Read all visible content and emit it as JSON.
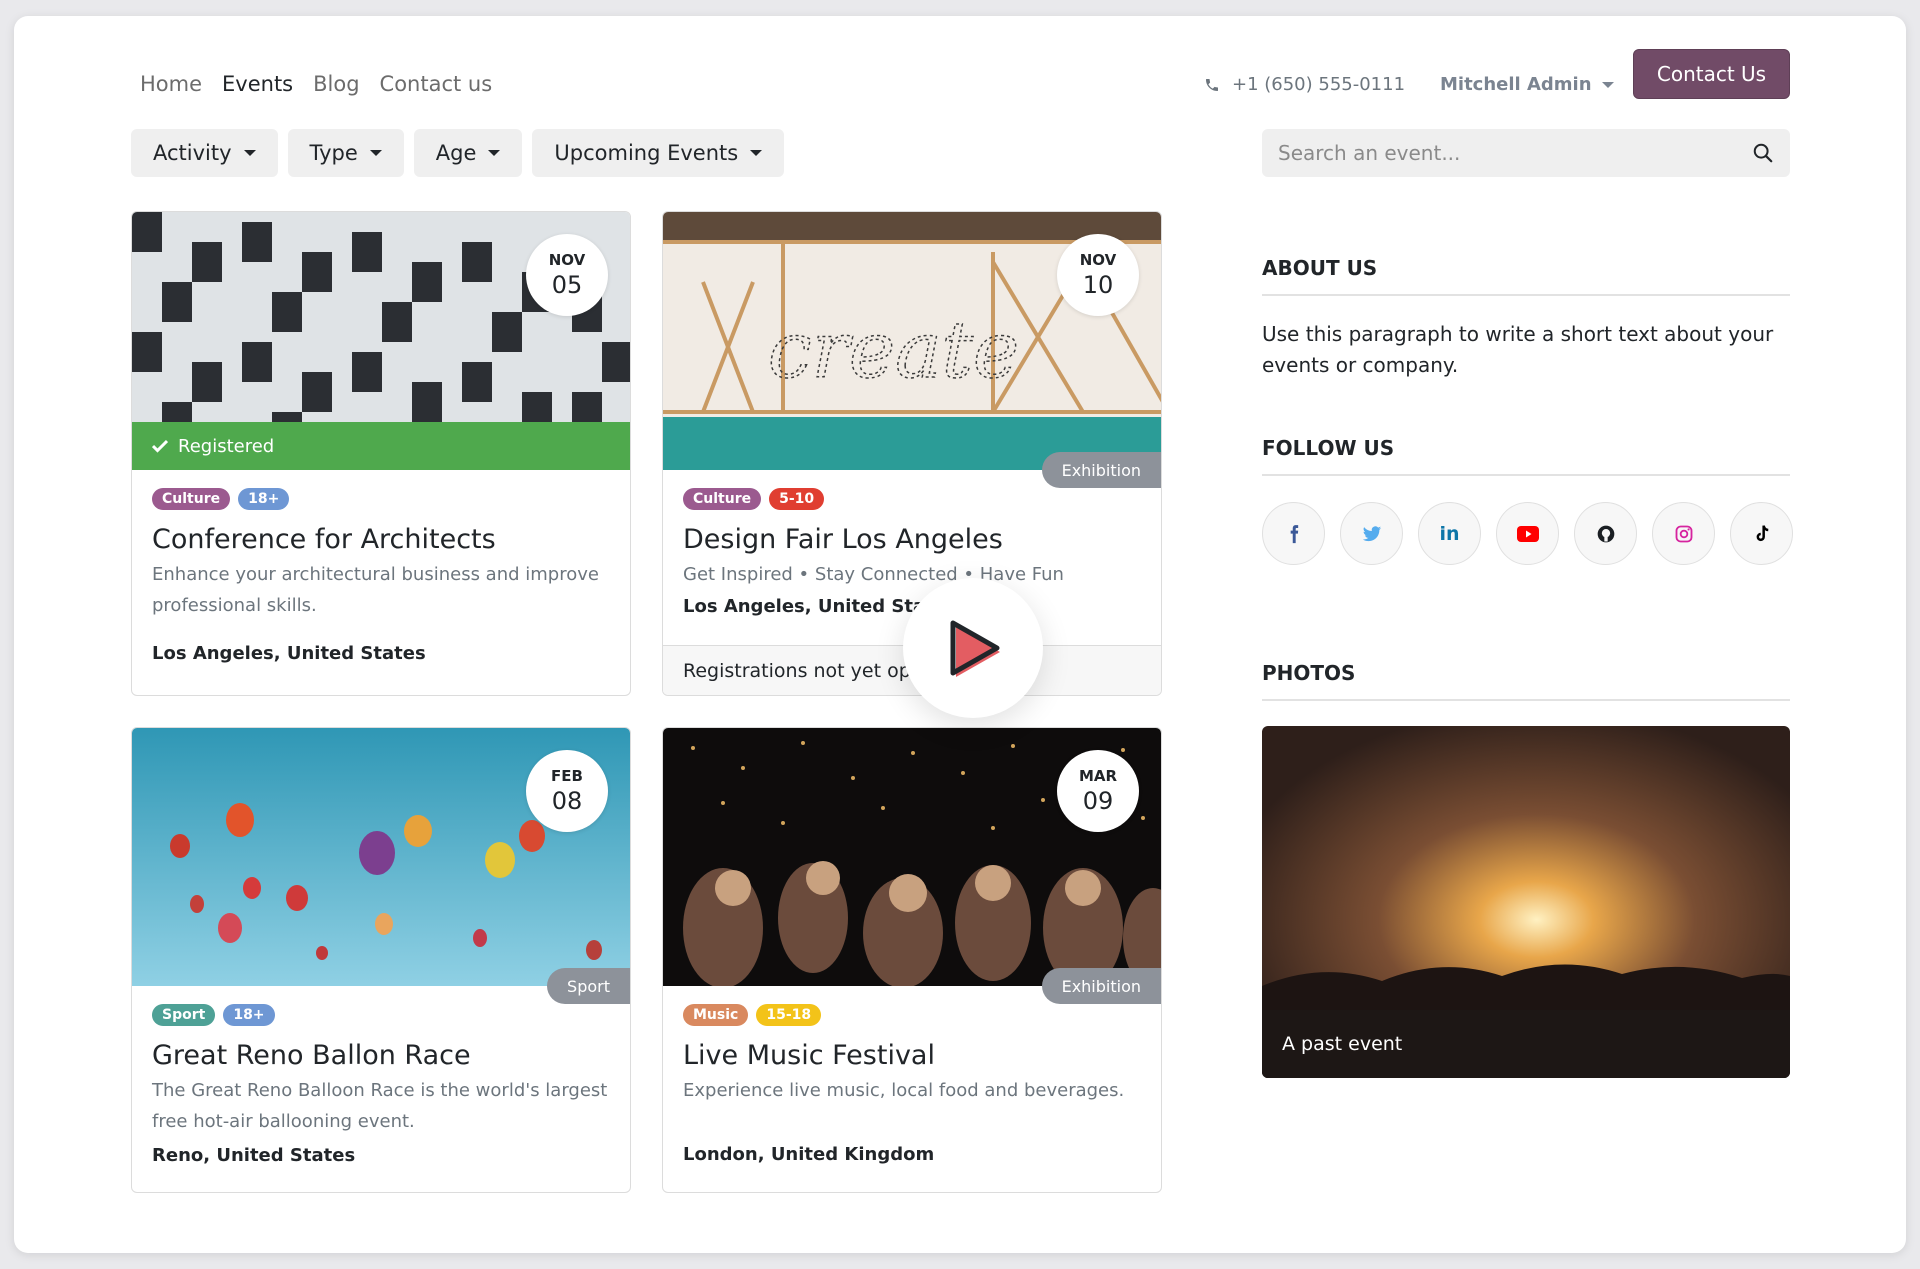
{
  "header": {
    "nav": [
      "Home",
      "Events",
      "Blog",
      "Contact us"
    ],
    "active_nav": "Events",
    "phone": "+1 (650) 555-0111",
    "user": "Mitchell Admin",
    "contact_button": "Contact Us"
  },
  "filters": {
    "items": [
      "Activity",
      "Type",
      "Age",
      "Upcoming Events"
    ],
    "search_placeholder": "Search an event..."
  },
  "events": [
    {
      "month": "NOV",
      "day": "05",
      "tags": [
        {
          "label": "Culture",
          "color": "#9b5a8f"
        },
        {
          "label": "18+",
          "color": "#6e97d4"
        }
      ],
      "title": "Conference for Architects",
      "description": "Enhance your architectural business and improve professional skills.",
      "location": "Los Angeles, United States",
      "registered_label": "Registered"
    },
    {
      "month": "NOV",
      "day": "10",
      "type_tag": "Exhibition",
      "tags": [
        {
          "label": "Culture",
          "color": "#9b5a8f"
        },
        {
          "label": "5-10",
          "color": "#e03e31"
        }
      ],
      "title": "Design Fair Los Angeles",
      "description": "Get Inspired • Stay Connected • Have Fun",
      "location": "Los Angeles, United States",
      "footer": "Registrations not yet open"
    },
    {
      "month": "FEB",
      "day": "08",
      "type_tag": "Sport",
      "tags": [
        {
          "label": "Sport",
          "color": "#4ea196"
        },
        {
          "label": "18+",
          "color": "#6e97d4"
        }
      ],
      "title": "Great Reno Ballon Race",
      "description": "The Great Reno Balloon Race is the world's largest free hot-air ballooning event.",
      "location": "Reno, United States"
    },
    {
      "month": "MAR",
      "day": "09",
      "type_tag": "Exhibition",
      "tags": [
        {
          "label": "Music",
          "color": "#d9895f"
        },
        {
          "label": "15-18",
          "color": "#f3c319"
        }
      ],
      "title": "Live Music Festival",
      "description": "Experience live music, local food and beverages.",
      "location": "London, United Kingdom"
    }
  ],
  "sidebar": {
    "about_heading": "ABOUT US",
    "about_text": "Use this paragraph to write a short text about your events or company.",
    "follow_heading": "FOLLOW US",
    "socials": [
      "facebook-icon",
      "twitter-icon",
      "linkedin-icon",
      "youtube-icon",
      "github-icon",
      "instagram-icon",
      "tiktok-icon"
    ],
    "photos_heading": "PHOTOS",
    "photo_caption": "A past event"
  },
  "colors": {
    "brand": "#714b67",
    "registered": "#4fa94d",
    "play": "#e35d62"
  }
}
